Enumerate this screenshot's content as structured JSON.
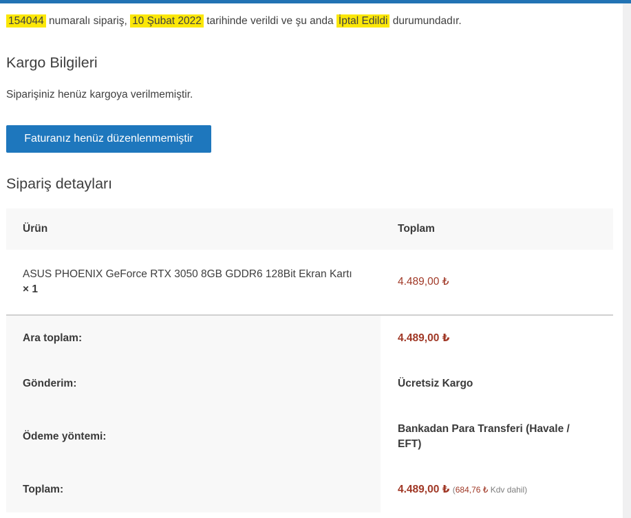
{
  "colors": {
    "accent_bar": "#2273b4",
    "button_blue": "#1e77bd",
    "highlight_yellow": "#fbe708",
    "price_red": "#a03826",
    "table_header_bg": "#f8f8f8"
  },
  "summary": {
    "order_number": "154044",
    "seg1": " numaralı sipariş, ",
    "order_date": "10 Şubat 2022",
    "seg2": " tarihinde verildi ve şu anda ",
    "order_status": "İptal Edildi",
    "seg3": " durumundadır."
  },
  "shipping": {
    "title": "Kargo Bilgileri",
    "message": "Siparişiniz henüz kargoya verilmemiştir."
  },
  "invoice": {
    "button_label": "Faturanız henüz düzenlenmemiştir"
  },
  "details": {
    "title": "Sipariş detayları",
    "headers": {
      "product": "Ürün",
      "total": "Toplam"
    },
    "items": [
      {
        "name": "ASUS PHOENIX GeForce RTX 3050 8GB GDDR6 128Bit Ekran Kartı",
        "quantity": "× 1",
        "total": "4.489,00 ₺"
      }
    ],
    "footer": [
      {
        "label": "Ara toplam:",
        "value": "4.489,00 ₺"
      },
      {
        "label": "Gönderim:",
        "value": "Ücretsiz Kargo"
      },
      {
        "label": "Ödeme yöntemi:",
        "value": "Bankadan Para Transferi (Havale / EFT)"
      },
      {
        "label": "Toplam:",
        "value": "4.489,00 ₺",
        "tax_prefix": "(",
        "tax_amount": "684,76 ₺",
        "tax_suffix": " Kdv dahil)"
      }
    ]
  }
}
